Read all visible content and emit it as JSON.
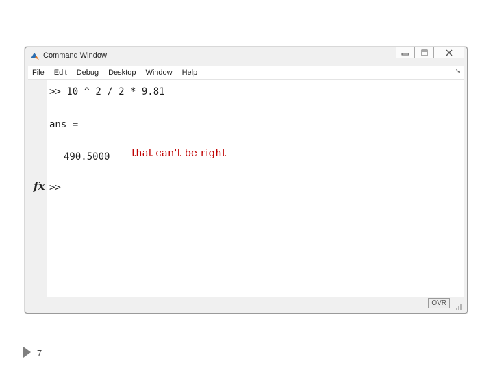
{
  "window": {
    "title": "Command Window",
    "controls": [
      "minimize-icon",
      "restore-icon",
      "close-icon"
    ]
  },
  "menubar": {
    "items": [
      "File",
      "Edit",
      "Debug",
      "Desktop",
      "Window",
      "Help"
    ],
    "overflow_icon": "chevron-icon"
  },
  "console": {
    "command": ">> 10 ^ 2 / 2 * 9.81",
    "result_label": "ans =",
    "result_value": "490.5000",
    "prompt": ">>",
    "fx_icon": "fx"
  },
  "annotation": "that can't be right",
  "statusbar": {
    "ovr": "OVR"
  },
  "footer": {
    "page_number": "7"
  }
}
